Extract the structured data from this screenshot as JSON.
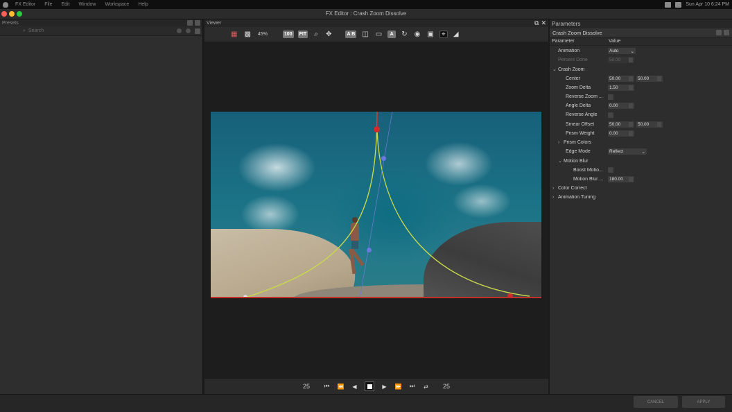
{
  "menubar": {
    "items": [
      "FX Editor",
      "File",
      "Edit",
      "Window",
      "Workspace",
      "Help"
    ],
    "clock": "Sun Apr 10  6:24 PM"
  },
  "window": {
    "title": "FX Editor : Crash Zoom Dissolve"
  },
  "traffic_colors": {
    "close": "#ff5f57",
    "minimize": "#febc2e",
    "zoom": "#28c840"
  },
  "browser": {
    "title": "Presets",
    "search_placeholder": "Search"
  },
  "viewer": {
    "title": "Viewer",
    "zoom": "45%",
    "btn_100": "100",
    "btn_fit": "FIT",
    "btn_ab": "A B",
    "btn_a": "A",
    "icons": [
      "color-channels-icon",
      "checkerboard-icon",
      "magnifier-icon",
      "pan-icon",
      "split-view-icon",
      "wipe-icon",
      "overlay-a-icon",
      "loop-icon",
      "snapshot-icon",
      "compare-icon",
      "crosshair-icon",
      "scopes-icon"
    ]
  },
  "transport": {
    "current_frame": "25",
    "end_frame": "25",
    "controls": [
      "go-to-start-icon",
      "step-back-icon",
      "play-reverse-icon",
      "stop-icon",
      "play-icon",
      "step-forward-icon",
      "go-to-end-icon",
      "loop-icon"
    ]
  },
  "parameters": {
    "title": "Parameters",
    "effect_name": "Crash Zoom Dissolve",
    "col_parameter": "Parameter",
    "col_value": "Value",
    "rows": [
      {
        "label": "Animation",
        "indent": 1,
        "type": "dropdown",
        "value": "Auto",
        "dim": false
      },
      {
        "label": "Percent Done",
        "indent": 1,
        "type": "number",
        "value": "50.00",
        "dim": true
      },
      {
        "label": "Crash Zoom",
        "indent": 0,
        "type": "group",
        "expanded": true,
        "dim": false
      },
      {
        "label": "Center",
        "indent": 2,
        "type": "pair",
        "value": "50.00",
        "value2": "50.00",
        "dim": false
      },
      {
        "label": "Zoom Delta",
        "indent": 2,
        "type": "number",
        "value": "1.50",
        "dim": false
      },
      {
        "label": "Reverse Zoom ...",
        "indent": 2,
        "type": "checkbox",
        "dim": false
      },
      {
        "label": "Angle Delta",
        "indent": 2,
        "type": "number",
        "value": "0.00",
        "dim": false
      },
      {
        "label": "Reverse Angle",
        "indent": 2,
        "type": "checkbox",
        "dim": false
      },
      {
        "label": "Smear Offset",
        "indent": 2,
        "type": "pair",
        "value": "50.00",
        "value2": "50.00",
        "dim": false
      },
      {
        "label": "Prism Weight",
        "indent": 2,
        "type": "number",
        "value": "0.00",
        "dim": false
      },
      {
        "label": "Prism Colors",
        "indent": 1,
        "type": "group",
        "expanded": false,
        "dim": false
      },
      {
        "label": "Edge Mode",
        "indent": 2,
        "type": "dropdown",
        "value": "Reflect",
        "dim": false
      },
      {
        "label": "Motion Blur",
        "indent": 1,
        "type": "group",
        "expanded": true,
        "dim": false
      },
      {
        "label": "Boost Motio...",
        "indent": 3,
        "type": "checkbox",
        "dim": false
      },
      {
        "label": "Motion Blur ...",
        "indent": 3,
        "type": "number",
        "value": "180.00",
        "dim": false
      },
      {
        "label": "Color Correct",
        "indent": 0,
        "type": "group",
        "expanded": false,
        "dim": false
      },
      {
        "label": "Animation Tuning",
        "indent": 0,
        "type": "group",
        "expanded": false,
        "dim": false
      }
    ]
  },
  "footer": {
    "cancel": "CANCEL",
    "apply": "APPLY"
  }
}
